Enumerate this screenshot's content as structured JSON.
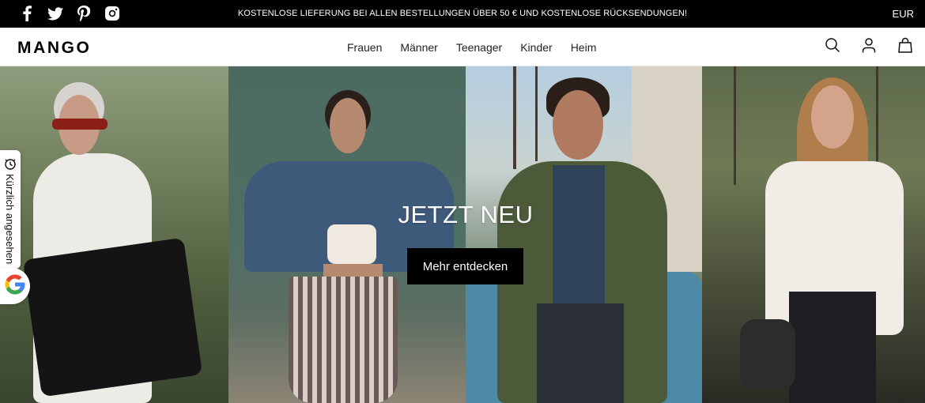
{
  "topbar": {
    "social": [
      {
        "name": "facebook-icon"
      },
      {
        "name": "twitter-icon"
      },
      {
        "name": "pinterest-icon"
      },
      {
        "name": "instagram-icon"
      }
    ],
    "promo_text": "KOSTENLOSE LIEFERUNG BEI ALLEN BESTELLUNGEN ÜBER 50 € UND KOSTENLOSE RÜCKSENDUNGEN!",
    "currency": "EUR"
  },
  "header": {
    "logo": "MANGO",
    "nav": [
      "Frauen",
      "Männer",
      "Teenager",
      "Kinder",
      "Heim"
    ],
    "icons": [
      "search-icon",
      "user-icon",
      "shopping-bag-icon"
    ]
  },
  "hero": {
    "title": "JETZT NEU",
    "button_label": "Mehr entdecken"
  },
  "sidetab": {
    "label": "Kürzlich angesehen",
    "icon": "recently-viewed-icon"
  },
  "google_button": {
    "icon": "google-icon",
    "letter": "G",
    "colors": {
      "blue": "#4285F4",
      "red": "#EA4335",
      "yellow": "#FBBC05",
      "green": "#34A853"
    }
  },
  "colors": {
    "topbar_bg": "#000000",
    "header_bg": "#ffffff",
    "button_bg": "#000000"
  }
}
